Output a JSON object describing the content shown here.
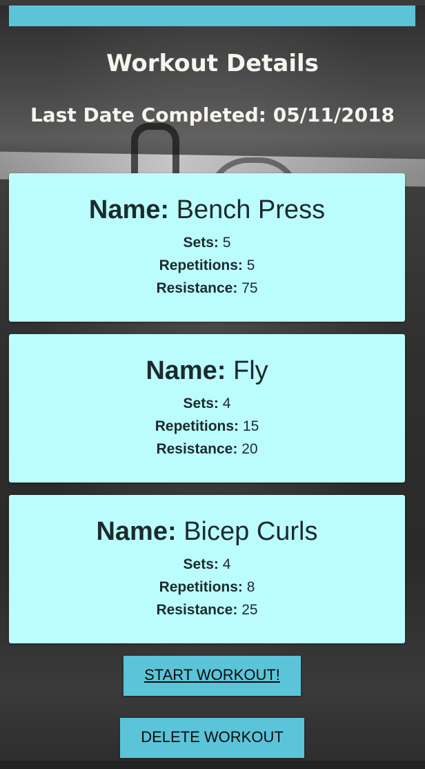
{
  "header": {
    "title": "Workout Details",
    "last_date_label": "Last Date Completed:",
    "last_date_value": "05/11/2018"
  },
  "labels": {
    "name": "Name:",
    "sets": "Sets:",
    "repetitions": "Repetitions:",
    "resistance": "Resistance:"
  },
  "exercises": [
    {
      "name": "Bench Press",
      "sets": "5",
      "repetitions": "5",
      "resistance": "75"
    },
    {
      "name": "Fly",
      "sets": "4",
      "repetitions": "15",
      "resistance": "20"
    },
    {
      "name": "Bicep Curls",
      "sets": "4",
      "repetitions": "8",
      "resistance": "25"
    }
  ],
  "actions": {
    "start_label": "START WORKOUT!",
    "delete_label": "DELETE WORKOUT"
  },
  "colors": {
    "accent": "#5bc4d8",
    "card_background": "#bbfdfd",
    "title_text": "#f8f4ef"
  }
}
